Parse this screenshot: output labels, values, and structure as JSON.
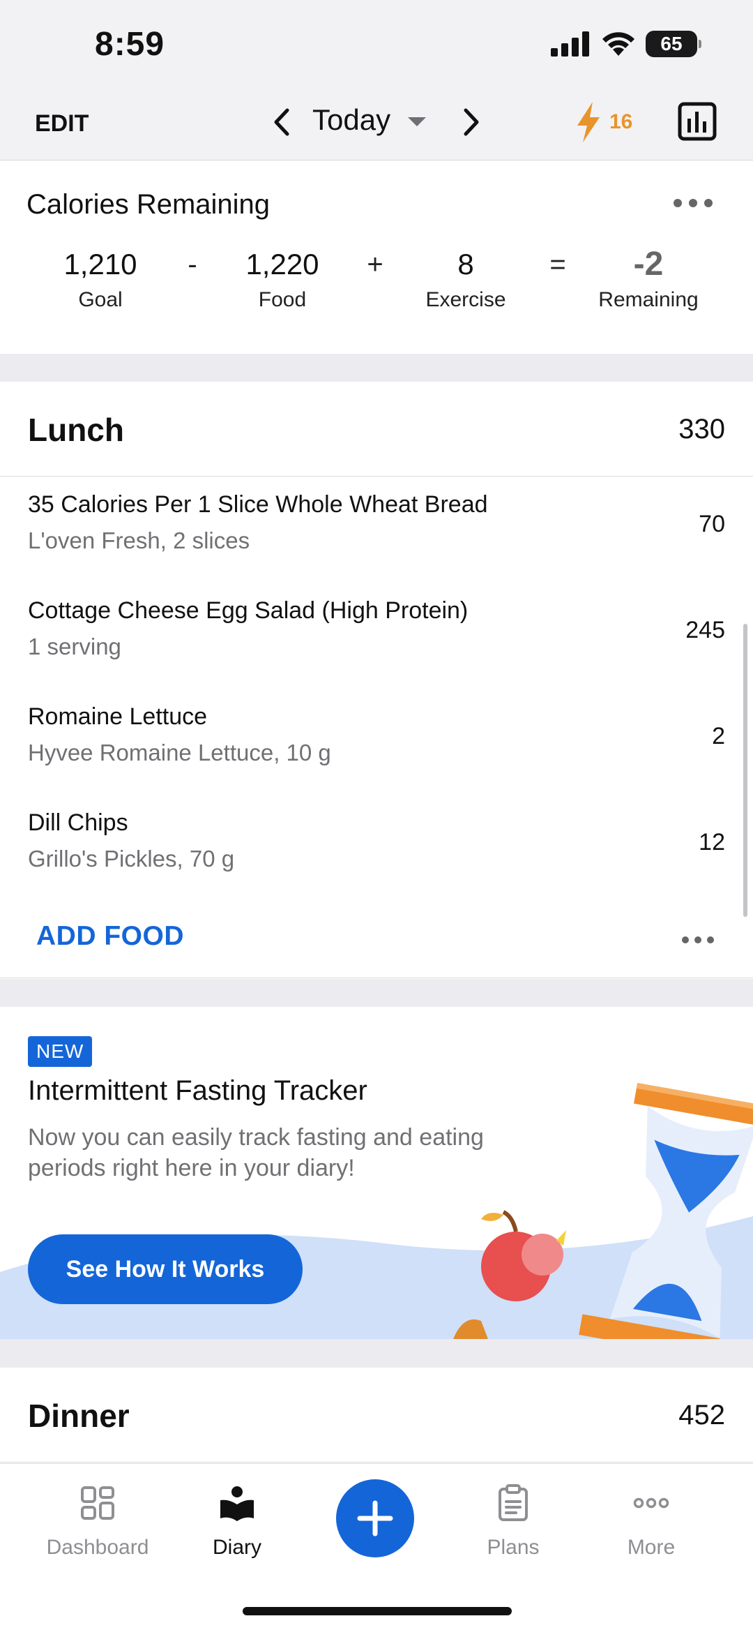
{
  "status_bar": {
    "time": "8:59",
    "battery": "65"
  },
  "header": {
    "edit_label": "EDIT",
    "date_label": "Today",
    "streak_count": "16",
    "colors": {
      "streak": "#e8942c",
      "accent": "#1466d8"
    }
  },
  "calories": {
    "title": "Calories Remaining",
    "goal_value": "1,210",
    "goal_label": "Goal",
    "op_minus": "-",
    "food_value": "1,220",
    "food_label": "Food",
    "op_plus": "+",
    "exercise_value": "8",
    "exercise_label": "Exercise",
    "op_equals": "=",
    "remaining_value": "-2",
    "remaining_label": "Remaining"
  },
  "lunch": {
    "title": "Lunch",
    "calories": "330",
    "items": [
      {
        "name": "35 Calories Per 1 Slice Whole Wheat Bread",
        "desc": "L'oven Fresh, 2 slices",
        "calories": "70"
      },
      {
        "name": "Cottage Cheese Egg Salad (High Protein)",
        "desc": "1 serving",
        "calories": "245"
      },
      {
        "name": "Romaine Lettuce",
        "desc": "Hyvee Romaine Lettuce, 10 g",
        "calories": "2"
      },
      {
        "name": "Dill Chips",
        "desc": "Grillo's Pickles, 70 g",
        "calories": "12"
      }
    ],
    "add_food_label": "ADD FOOD"
  },
  "promo": {
    "badge": "NEW",
    "title": "Intermittent Fasting Tracker",
    "description": "Now you can easily track fasting and eating periods right here in your diary!",
    "button_label": "See How It Works"
  },
  "dinner": {
    "title": "Dinner",
    "calories": "452"
  },
  "tabs": [
    {
      "label": "Dashboard",
      "icon": "dashboard-grid-icon"
    },
    {
      "label": "Diary",
      "icon": "diary-book-icon"
    },
    {
      "label": "Plans",
      "icon": "clipboard-icon"
    },
    {
      "label": "More",
      "icon": "more-dots-icon"
    }
  ]
}
